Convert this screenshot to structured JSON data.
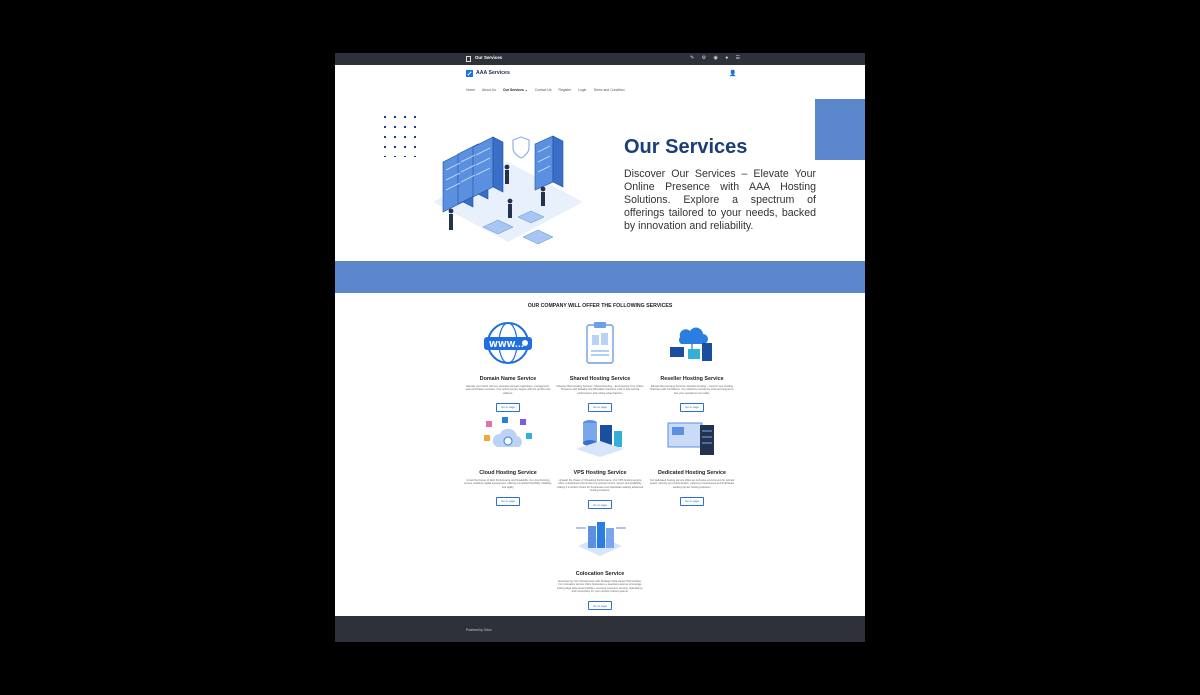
{
  "topbar": {
    "title": "Our Services",
    "tools": "✎ ⚙ ◉ ● ☰"
  },
  "header": {
    "site_name": "AAA Services",
    "user_icon": "user-icon",
    "nav": [
      "Home",
      "About Us",
      "Our Services ⌄",
      "Contact Us",
      "Register",
      "Login",
      "Terms and Condition"
    ]
  },
  "hero": {
    "title": "Our Services",
    "text": "Discover Our Services – Elevate Your Online Presence with AAA Hosting Solutions. Explore a spectrum of offerings tailored to your needs, backed by innovation and reliability.",
    "accent_color": "#5b87cc"
  },
  "services": {
    "heading": "OUR COMPANY WILL OFFER THE FOLLOWING SERVICES",
    "items": [
      {
        "name": "Domain Name Service",
        "desc": "Elevate your brand with our seamless domain registration, management, and optimization services. Your online journey begins with the perfect web address.",
        "button": "Go to page",
        "icon": "globe-www-icon"
      },
      {
        "name": "Shared Hosting Service",
        "desc": "Discover Best Hosting Services: Shared Hosting – Empowering Your Online Presence with Reliable and Affordable Solutions, built to fuel optimal performance and cutting-edge features.",
        "button": "Go to page",
        "icon": "clipboard-server-icon"
      },
      {
        "name": "Reseller Hosting Service",
        "desc": "Elevate Best Hosting Services: Reseller Hosting – Launch Your Hosting Business with Confidence. Our solutions provide the tools and support to fuel your operations into reality.",
        "button": "Go to page",
        "icon": "cloud-computers-icon"
      },
      {
        "name": "Cloud Hosting Service",
        "desc": "Unveil the Future of Web Performance and Scalability. Our cloud hosting service redefines digital experiences, offering unmatched flexibility, reliability, and agility.",
        "button": "Go to page",
        "icon": "cloud-apps-icon"
      },
      {
        "name": "VPS Hosting Service",
        "desc": "Unleash the Power of Virtualized Performance: Our VPS hosting service offers a dedicated environment for optimal control, speed, and scalability, making it a perfect choice for businesses and individuals seeking advanced hosting solutions.",
        "button": "Go to page",
        "icon": "server-stack-icon"
      },
      {
        "name": "Dedicated Hosting Service",
        "desc": "Our dedicated hosting service offers an exclusive environment for optimal speed, security and customization, catering to businesses and individuals seeking top-tier hosting solutions.",
        "button": "Go to page",
        "icon": "dedicated-server-icon"
      },
      {
        "name": "Colocation Service",
        "desc": "Empowering Your Infrastructure with Strategic Data Center Partnerships. Our colocation service offers businesses a seamless avenue to leverage cutting-edge data center facilities, ensuring maximum security, redundancy, and connectivity for your mission-critical systems.",
        "button": "Go to page",
        "icon": "colocation-icon"
      }
    ]
  },
  "footer": {
    "text": "Powered by Odoo"
  }
}
